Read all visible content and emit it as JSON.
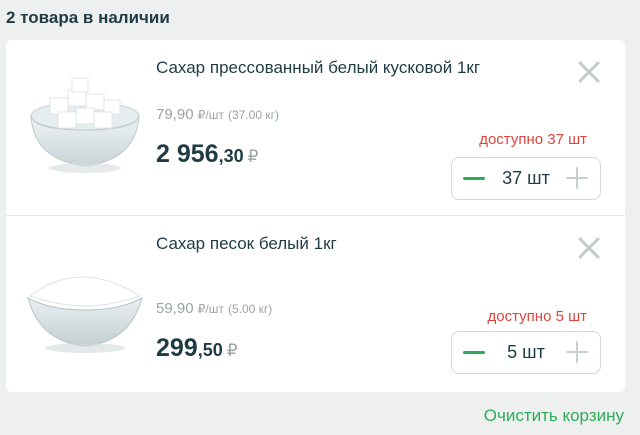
{
  "header": {
    "title": "2 товара в наличии"
  },
  "items": [
    {
      "title": "Сахар прессованный белый кусковой 1кг",
      "price_per_unit": "79,90",
      "unit_suffix": "₽/шт",
      "unit_note": "(37.00 кг)",
      "total_int": "2 956",
      "total_cents": ",30",
      "currency": "₽",
      "availability": "доступно 37 шт",
      "quantity": "37 шт",
      "icon": "sugar-cubes-bowl"
    },
    {
      "title": "Сахар песок белый 1кг",
      "price_per_unit": "59,90",
      "unit_suffix": "₽/шт",
      "unit_note": "(5.00 кг)",
      "total_int": "299",
      "total_cents": ",50",
      "currency": "₽",
      "availability": "доступно 5 шт",
      "quantity": "5 шт",
      "icon": "granulated-sugar-bowl"
    }
  ],
  "footer": {
    "clear_label": "Очистить корзину"
  },
  "colors": {
    "accent": "#2faa5c",
    "warning": "#e0433c",
    "text": "#1f3b44",
    "muted": "#9aa3a6"
  }
}
